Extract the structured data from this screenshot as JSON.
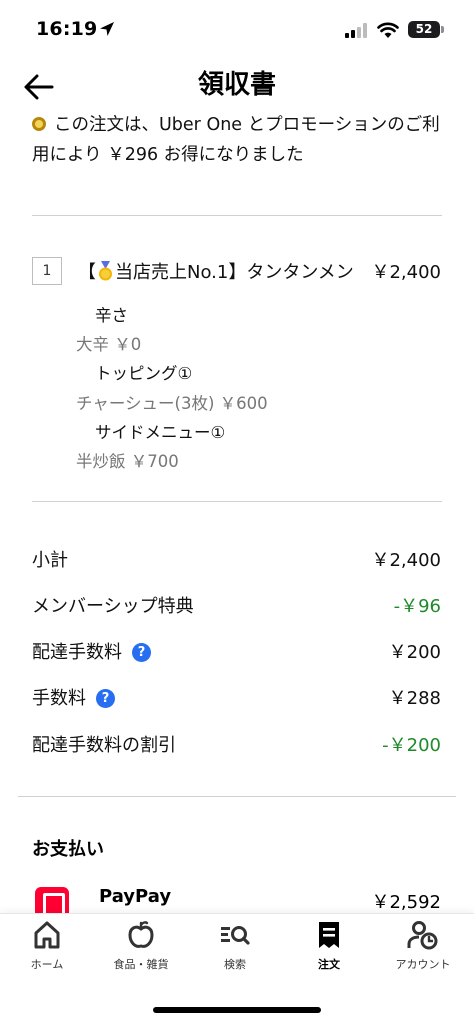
{
  "status_bar": {
    "time": "16:19",
    "battery": "52"
  },
  "header": {
    "title": "領収書"
  },
  "promo": {
    "text": "この注文は、Uber One とプロモーションのご利用により ￥296 お得になりました"
  },
  "item": {
    "quantity": "1",
    "name_prefix": "【",
    "name_rest": "当店売上No.1】タンタンメン",
    "price": "￥2,400",
    "options": [
      {
        "heading": "辛さ",
        "value": "大辛 ￥0"
      },
      {
        "heading": "トッピング①",
        "value": "チャーシュー(3枚) ￥600"
      },
      {
        "heading": "サイドメニュー①",
        "value": "半炒飯 ￥700"
      }
    ]
  },
  "summary": {
    "subtotal_label": "小計",
    "subtotal_value": "￥2,400",
    "membership_label": "メンバーシップ特典",
    "membership_value": "-￥96",
    "delivery_fee_label": "配達手数料",
    "delivery_fee_value": "￥200",
    "service_fee_label": "手数料",
    "service_fee_value": "￥288",
    "delivery_discount_label": "配達手数料の割引",
    "delivery_discount_value": "-￥200"
  },
  "payment": {
    "heading": "お支払い",
    "method": "PayPay",
    "amount": "￥2,592"
  },
  "tabs": [
    {
      "label": "ホーム",
      "icon": "home-icon"
    },
    {
      "label": "食品・雑貨",
      "icon": "apple-icon"
    },
    {
      "label": "検索",
      "icon": "search-icon"
    },
    {
      "label": "注文",
      "icon": "receipt-icon"
    },
    {
      "label": "アカウント",
      "icon": "account-icon"
    }
  ],
  "colors": {
    "discount": "#1f8a2c",
    "help": "#276ef1",
    "paypay": "#ff0033"
  }
}
